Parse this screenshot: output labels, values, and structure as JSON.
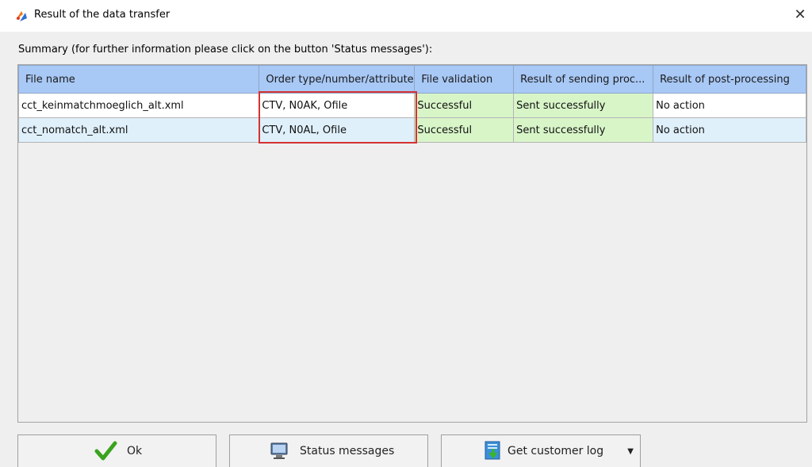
{
  "window": {
    "title": "Result of the data transfer",
    "close_label": "✕"
  },
  "summary": "Summary (for further information please click on the button 'Status messages'):",
  "table": {
    "columns": [
      "File name",
      "Order type/number/attribute",
      "File validation",
      "Result of sending proc...",
      "Result of post-processing"
    ],
    "rows": [
      [
        "cct_keinmatchmoeglich_alt.xml",
        "CTV, N0AK, Ofile",
        "Successful",
        "Sent successfully",
        "No action"
      ],
      [
        "cct_nomatch_alt.xml",
        "CTV, N0AL, Ofile",
        "Successful",
        "Sent successfully",
        "No action"
      ]
    ]
  },
  "buttons": {
    "ok": "Ok",
    "status": "Status messages",
    "log": "Get customer log",
    "dropdown_glyph": "▼"
  },
  "colors": {
    "header": "#a8c8f5",
    "success_cell": "#d8f5c8",
    "highlight": "#d63232"
  },
  "icons": [
    "app-logo-icon",
    "close-icon",
    "checkmark-icon",
    "monitor-icon",
    "log-download-icon",
    "dropdown-arrow-icon"
  ]
}
